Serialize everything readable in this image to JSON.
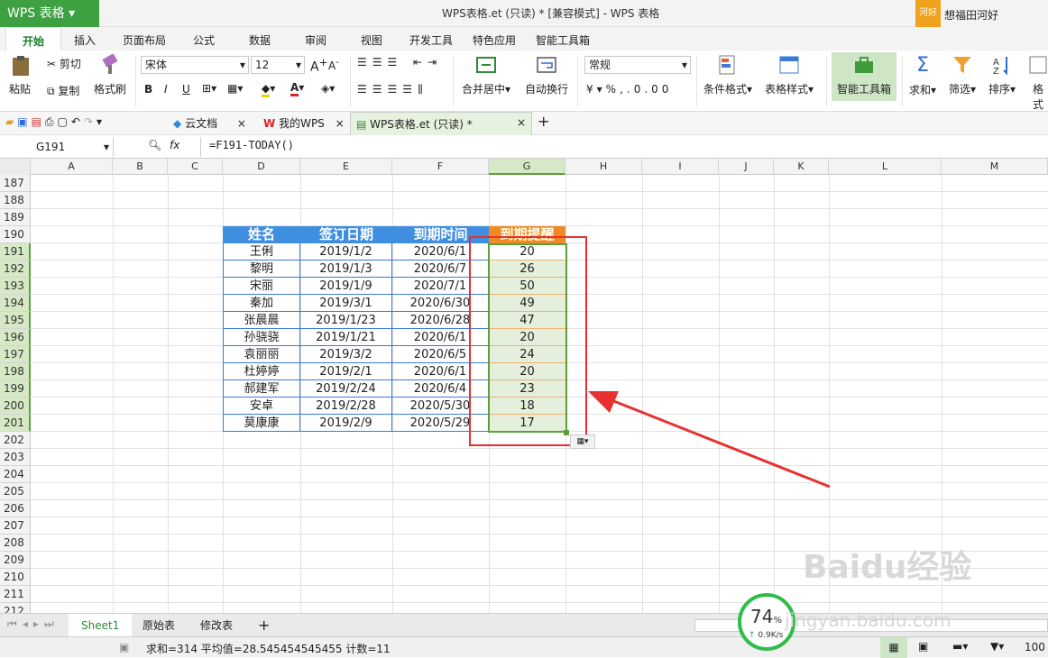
{
  "app": {
    "name": "WPS 表格",
    "window_title": "WPS表格.et (只读) * [兼容模式] - WPS 表格",
    "user_badge": "河好",
    "user_name": "想福田河好"
  },
  "ribbon_tabs": [
    "开始",
    "插入",
    "页面布局",
    "公式",
    "数据",
    "审阅",
    "视图",
    "开发工具",
    "特色应用",
    "智能工具箱"
  ],
  "ribbon": {
    "paste": "粘贴",
    "cut": "剪切",
    "copy": "复制",
    "format_painter": "格式刷",
    "font": "宋体",
    "size": "12",
    "merge_center": "合并居中",
    "wrap": "自动换行",
    "number_format": "常规",
    "cond_format": "条件格式",
    "table_style": "表格样式",
    "smart_toolbox": "智能工具箱",
    "sum": "求和",
    "filter": "筛选",
    "sort": "排序",
    "format": "格式"
  },
  "doc_tabs": [
    "云文档",
    "我的WPS",
    "WPS表格.et (只读) *"
  ],
  "formula_bar": {
    "cell_ref": "G191",
    "fx": "fx",
    "formula": "=F191-TODAY()"
  },
  "columns": [
    "A",
    "B",
    "C",
    "D",
    "E",
    "F",
    "G",
    "H",
    "I",
    "J",
    "K",
    "L",
    "M"
  ],
  "rows": [
    187,
    188,
    189,
    190,
    191,
    192,
    193,
    194,
    195,
    196,
    197,
    198,
    199,
    200,
    201,
    202,
    203,
    204,
    205,
    206,
    207,
    208,
    209,
    210,
    211,
    212
  ],
  "table": {
    "headers": [
      "姓名",
      "签订日期",
      "到期时间",
      "到期提醒"
    ],
    "data": [
      [
        "王俐",
        "2019/1/2",
        "2020/6/1",
        "20"
      ],
      [
        "黎明",
        "2019/1/3",
        "2020/6/7",
        "26"
      ],
      [
        "宋丽",
        "2019/1/9",
        "2020/7/1",
        "50"
      ],
      [
        "秦加",
        "2019/3/1",
        "2020/6/30",
        "49"
      ],
      [
        "张晨晨",
        "2019/1/23",
        "2020/6/28",
        "47"
      ],
      [
        "孙骁骁",
        "2019/1/21",
        "2020/6/1",
        "20"
      ],
      [
        "袁丽丽",
        "2019/3/2",
        "2020/6/5",
        "24"
      ],
      [
        "杜婷婷",
        "2019/2/1",
        "2020/6/1",
        "20"
      ],
      [
        "郝建军",
        "2019/2/24",
        "2020/6/4",
        "23"
      ],
      [
        "安卓",
        "2019/2/28",
        "2020/5/30",
        "18"
      ],
      [
        "莫康康",
        "2019/2/9",
        "2020/5/29",
        "17"
      ]
    ]
  },
  "sheets": [
    "Sheet1",
    "原始表",
    "修改表"
  ],
  "status": {
    "text": "求和=314  平均值=28.545454545455  计数=11",
    "zoom": "100"
  },
  "speed": {
    "percent": "74",
    "unit": "%",
    "rate": "0.9K/s"
  },
  "watermark": {
    "text": "Baidu经验",
    "url": "jingyan.baidu.com"
  }
}
